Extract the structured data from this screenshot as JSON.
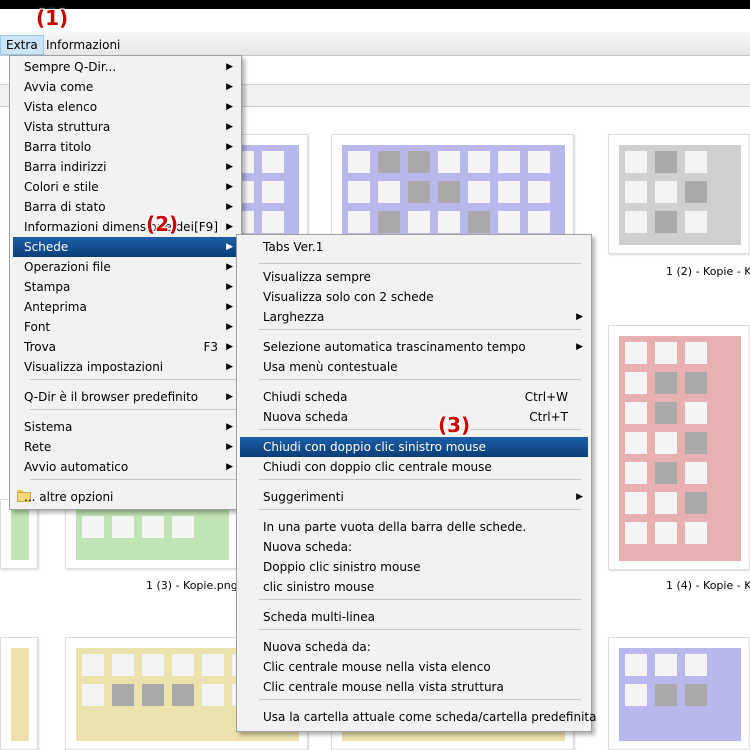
{
  "annotations": [
    "(1)",
    "(2)",
    "(3)"
  ],
  "menubar": {
    "items": [
      "Extra",
      "Informazioni"
    ]
  },
  "extra_menu": {
    "items": [
      {
        "label": "Sempre Q-Dir...",
        "submenu": true
      },
      {
        "label": "Avvia come",
        "submenu": true
      },
      {
        "label": "Vista elenco",
        "submenu": true
      },
      {
        "label": "Vista struttura",
        "submenu": true
      },
      {
        "label": "Barra titolo",
        "submenu": true
      },
      {
        "label": "Barra indirizzi",
        "submenu": true
      },
      {
        "label": "Colori e stile",
        "submenu": true
      },
      {
        "label": "Barra di stato",
        "submenu": true
      },
      {
        "label": "Informazioni dimensione dei",
        "shortcut": "[F9]",
        "submenu": true
      },
      {
        "label": "Schede",
        "submenu": true,
        "highlighted": true
      },
      {
        "label": "Operazioni file",
        "submenu": true
      },
      {
        "label": "Stampa",
        "submenu": true
      },
      {
        "label": "Anteprima",
        "submenu": true
      },
      {
        "label": "Font",
        "submenu": true
      },
      {
        "label": "Trova",
        "shortcut": "F3",
        "submenu": true
      },
      {
        "label": "Visualizza impostazioni",
        "submenu": true
      },
      {
        "label": "Q-Dir è il browser predefinito",
        "submenu": true
      },
      {
        "label": "Sistema",
        "submenu": true
      },
      {
        "label": "Rete",
        "submenu": true
      },
      {
        "label": "Avvio automatico",
        "submenu": true
      },
      {
        "label": "... altre opzioni",
        "icon": "folder-icon"
      }
    ]
  },
  "schede_menu": {
    "items": [
      {
        "label": "Tabs Ver.1"
      },
      {
        "label": "Visualizza sempre"
      },
      {
        "label": "Visualizza solo con 2 schede"
      },
      {
        "label": "Larghezza",
        "submenu": true
      },
      {
        "label": "Selezione automatica trascinamento tempo",
        "submenu": true
      },
      {
        "label": "Usa menù contestuale"
      },
      {
        "label": "Chiudi scheda",
        "shortcut": "Ctrl+W"
      },
      {
        "label": "Nuova scheda",
        "shortcut": "Ctrl+T"
      },
      {
        "label": "Chiudi con doppio clic sinistro mouse",
        "highlighted": true
      },
      {
        "label": "Chiudi con doppio clic centrale mouse"
      },
      {
        "label": "Suggerimenti",
        "submenu": true
      },
      {
        "label": "In una parte vuota della barra delle schede."
      },
      {
        "label": "Nuova scheda:"
      },
      {
        "label": "Doppio clic sinistro mouse"
      },
      {
        "label": "clic sinistro mouse"
      },
      {
        "label": "Scheda multi-linea"
      },
      {
        "label": "Nuova scheda da:"
      },
      {
        "label": "Clic centrale mouse nella vista elenco"
      },
      {
        "label": "Clic centrale mouse nella vista struttura"
      },
      {
        "label": "Usa la cartella attuale come scheda/cartella predefinita"
      }
    ]
  },
  "files": [
    {
      "name": "1 (2) - Kopie - K"
    },
    {
      "name": "1 (3) - Kopie.png"
    },
    {
      "name": "1 (4) - Kopie - K"
    }
  ],
  "colors": {
    "highlight": "#0f4a8c",
    "annotation": "#cc0000",
    "thumb_blue": "#b8b8ec",
    "thumb_gray": "#cfcfcf",
    "thumb_red": "#e8b0b0",
    "thumb_green": "#bfe3b5",
    "thumb_yellow": "#ebe2ad",
    "thumb_dark": "#a9a9a9"
  }
}
